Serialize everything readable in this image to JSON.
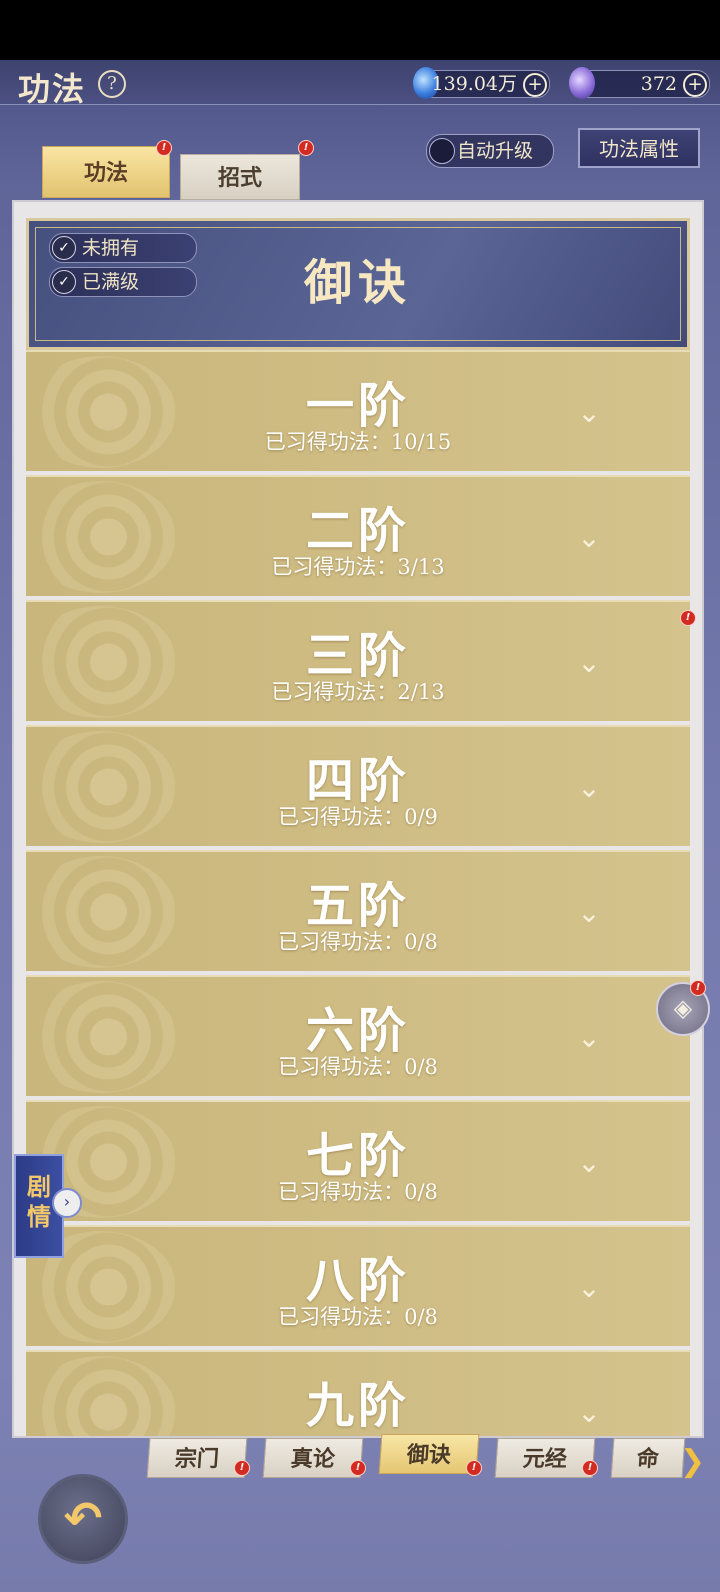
{
  "header": {
    "title": "功法",
    "help_glyph": "?",
    "currency1": {
      "value": "139.04万",
      "plus": "+"
    },
    "currency2": {
      "value": "372",
      "plus": "+"
    }
  },
  "controls": {
    "auto_upgrade_label": "自动升级",
    "attributes_label": "功法属性"
  },
  "tabs": [
    {
      "label": "功法",
      "active": true,
      "badge": true
    },
    {
      "label": "招式",
      "active": false,
      "badge": true
    }
  ],
  "panel": {
    "title": "御诀",
    "filters": [
      {
        "label": "未拥有",
        "checked": true
      },
      {
        "label": "已满级",
        "checked": true
      }
    ]
  },
  "tiers": [
    {
      "name": "一阶",
      "count": "已习得功法：10/15",
      "badge": false
    },
    {
      "name": "二阶",
      "count": "已习得功法：3/13",
      "badge": false
    },
    {
      "name": "三阶",
      "count": "已习得功法：2/13",
      "badge": true
    },
    {
      "name": "四阶",
      "count": "已习得功法：0/9",
      "badge": false
    },
    {
      "name": "五阶",
      "count": "已习得功法：0/8",
      "badge": false
    },
    {
      "name": "六阶",
      "count": "已习得功法：0/8",
      "badge": false
    },
    {
      "name": "七阶",
      "count": "已习得功法：0/8",
      "badge": false
    },
    {
      "name": "八阶",
      "count": "已习得功法：0/8",
      "badge": false
    },
    {
      "name": "九阶",
      "count": "",
      "badge": false
    }
  ],
  "story": {
    "label": "剧情"
  },
  "bottom_tabs": [
    {
      "label": "宗门",
      "active": false,
      "badge": true
    },
    {
      "label": "真论",
      "active": false,
      "badge": true
    },
    {
      "label": "御诀",
      "active": true,
      "badge": true
    },
    {
      "label": "元经",
      "active": false,
      "badge": true
    },
    {
      "label": "命",
      "active": false,
      "badge": false
    }
  ],
  "icons": {
    "badge_glyph": "!",
    "check_glyph": "✓",
    "chevron_glyph": "⌄",
    "back_glyph": "↶",
    "more_glyph": "❯",
    "story_arrow_glyph": "›",
    "side_glyph": "◈"
  },
  "colors": {
    "accent_gold": "#e2c36f",
    "badge_red": "#d32a22",
    "panel_navy": "#46507f"
  }
}
